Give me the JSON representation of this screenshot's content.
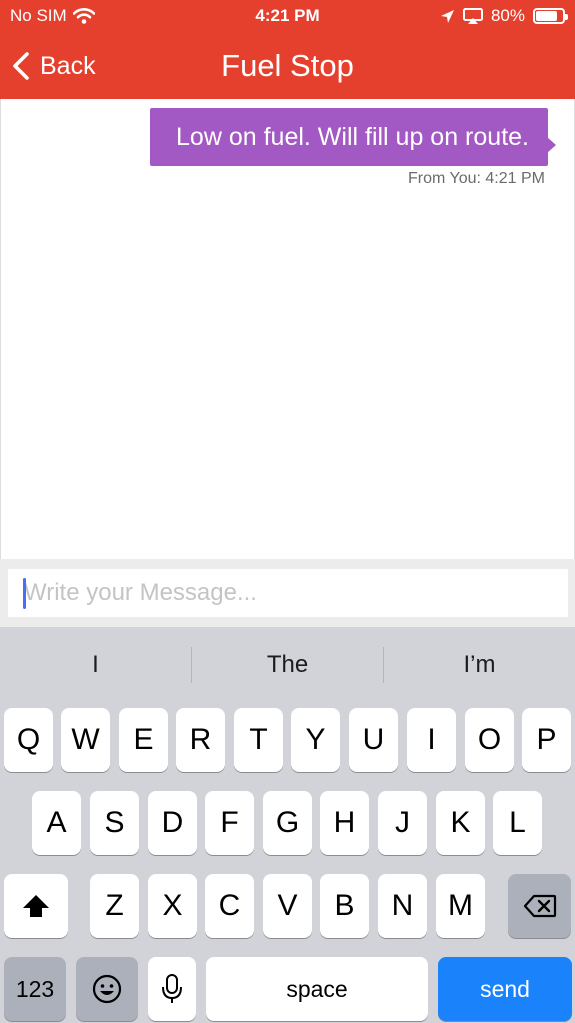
{
  "status_bar": {
    "carrier": "No SIM",
    "time": "4:21 PM",
    "battery": "80%",
    "battery_level": 0.8
  },
  "nav": {
    "back_label": "Back",
    "title": "Fuel Stop"
  },
  "messages": [
    {
      "text": "Low on fuel. Will fill up on route.",
      "meta": "From You: 4:21 PM"
    }
  ],
  "composer": {
    "placeholder": "Write your Message..."
  },
  "keyboard": {
    "suggestions": [
      "I",
      "The",
      "I’m"
    ],
    "row1": [
      "Q",
      "W",
      "E",
      "R",
      "T",
      "Y",
      "U",
      "I",
      "O",
      "P"
    ],
    "row2": [
      "A",
      "S",
      "D",
      "F",
      "G",
      "H",
      "J",
      "K",
      "L"
    ],
    "row3": [
      "Z",
      "X",
      "C",
      "V",
      "B",
      "N",
      "M"
    ],
    "numbers_label": "123",
    "space_label": "space",
    "send_label": "send"
  },
  "colors": {
    "header": "#e5402e",
    "bubble": "#a259c3",
    "send": "#1a82fb"
  }
}
